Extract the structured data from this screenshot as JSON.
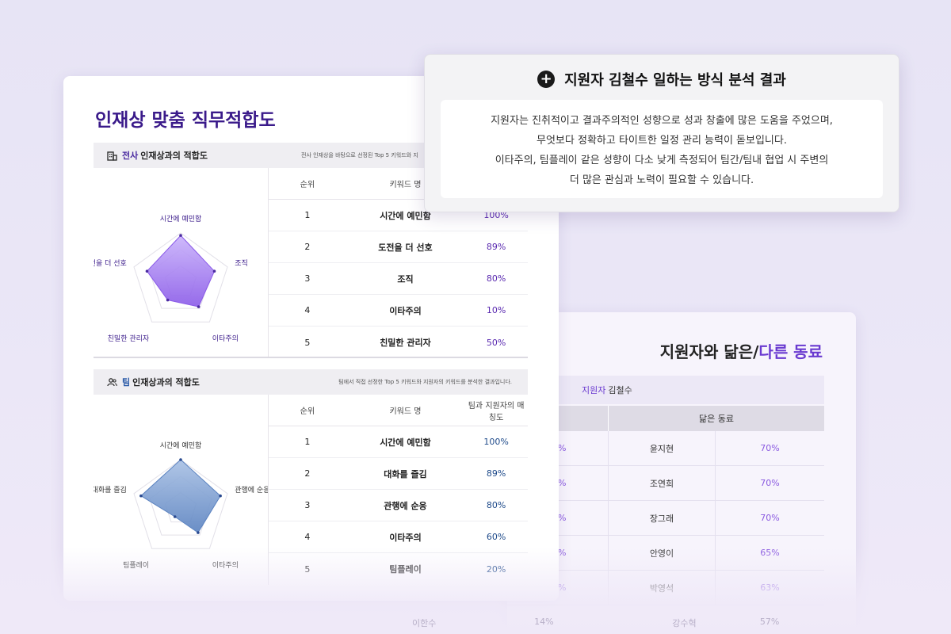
{
  "main": {
    "title": "인재상 맞춤 직무적합도",
    "company_section": {
      "accent": "전사",
      "title": "인재상과의 적합도",
      "description": "전사 인재상을 바탕으로 선정된 Top 5 키워드와 지",
      "radar_labels": [
        "시간에 예민함",
        "조직",
        "이타주의",
        "친밀한 관리자",
        "도전을 더 선호"
      ],
      "radar_values": [
        0.95,
        0.72,
        0.62,
        0.45,
        0.72
      ],
      "columns": [
        "순위",
        "키워드 명",
        ""
      ],
      "rows": [
        {
          "rank": "1",
          "keyword": "시간에 예민함",
          "pct": "100%"
        },
        {
          "rank": "2",
          "keyword": "도전을 더 선호",
          "pct": "89%"
        },
        {
          "rank": "3",
          "keyword": "조직",
          "pct": "80%"
        },
        {
          "rank": "4",
          "keyword": "이타주의",
          "pct": "10%"
        },
        {
          "rank": "5",
          "keyword": "친밀한 관리자",
          "pct": "50%"
        }
      ]
    },
    "team_section": {
      "accent": "팀",
      "title": "인재상과의 적합도",
      "description": "팀에서 직접 선정한 Top 5 키워드와 지원자의 키워드를 분석한 결과입니다.",
      "radar_labels": [
        "시간에 예민함",
        "관행에 순응",
        "이타주의",
        "팀플레이",
        "대화를 즐김"
      ],
      "radar_values": [
        1.0,
        0.85,
        0.6,
        0.2,
        0.85
      ],
      "columns": [
        "순위",
        "키워드 명",
        "팀과 지원자의 매칭도"
      ],
      "rows": [
        {
          "rank": "1",
          "keyword": "시간에 예민함",
          "pct": "100%"
        },
        {
          "rank": "2",
          "keyword": "대화를 즐김",
          "pct": "89%"
        },
        {
          "rank": "3",
          "keyword": "관행에 순응",
          "pct": "80%"
        },
        {
          "rank": "4",
          "keyword": "이타주의",
          "pct": "60%"
        },
        {
          "rank": "5",
          "keyword": "팀플레이",
          "pct": "20%"
        }
      ]
    }
  },
  "popup": {
    "icon": "plus-circle-icon",
    "title": "지원자 김철수 일하는 방식 분석 결과",
    "lines": [
      "지원자는 진취적이고 결과주의적인 성향으로 성과 창출에 많은 도움을 주었으며,",
      "무엇보다 정확하고 타이트한 일정 관리 능력이 돋보입니다.",
      "이타주의, 팀플레이 같은 성향이 다소 낮게 측정되어 팀간/팀내 협업 시 주변의",
      "더 많은 관심과 노력이 필요할 수 있습니다."
    ]
  },
  "right": {
    "title_plain": "지원자와 닮은/",
    "title_accent": "다른 동료",
    "applicant_accent": "지원자",
    "applicant_name": "김철수",
    "column_similar": "닮은 동료",
    "rows": [
      {
        "left": "%",
        "name": "윤지현",
        "pct": "70%"
      },
      {
        "left": "%",
        "name": "조연희",
        "pct": "70%"
      },
      {
        "left": "%",
        "name": "장그래",
        "pct": "70%"
      },
      {
        "left": "%",
        "name": "안영이",
        "pct": "65%"
      },
      {
        "left": "%",
        "name": "박영석",
        "pct": "63%"
      }
    ],
    "ghost_row": {
      "a": "이한수",
      "b": "14%",
      "name": "강수혁",
      "pct": "57%"
    }
  },
  "colors": {
    "purple_accent": "#6a3ad0",
    "main_title": "#3a1a8a",
    "radar_purple": "#8a5ae8",
    "radar_blue": "#5a82c0"
  }
}
